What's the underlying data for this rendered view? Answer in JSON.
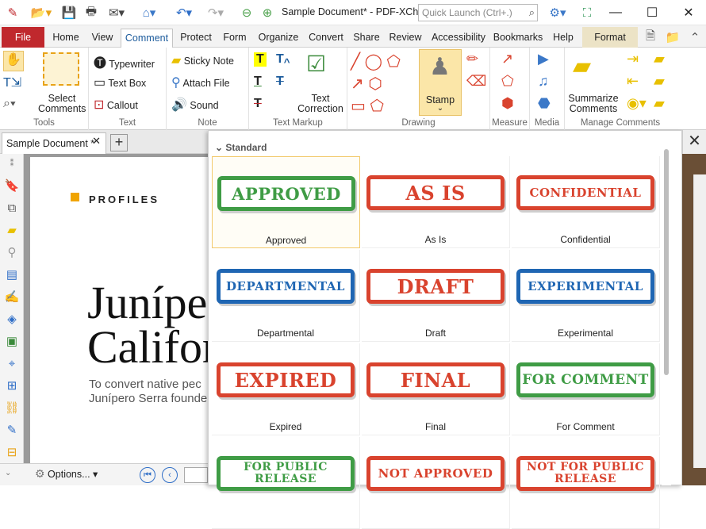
{
  "window": {
    "title": "Sample Document* - PDF-XCh...",
    "quick_launch_placeholder": "Quick Launch (Ctrl+.)"
  },
  "tabs": [
    "File",
    "Home",
    "View",
    "Comment",
    "Protect",
    "Form",
    "Organize",
    "Convert",
    "Share",
    "Review",
    "Accessibility",
    "Bookmarks",
    "Help",
    "Format"
  ],
  "ribbon": {
    "tools": {
      "select_comments": "Select\nComments",
      "group": "Tools"
    },
    "text": {
      "typewriter": "Typewriter",
      "text_box": "Text Box",
      "callout": "Callout",
      "group": "Text"
    },
    "note": {
      "sticky_note": "Sticky Note",
      "attach_file": "Attach File",
      "sound": "Sound",
      "group": "Note"
    },
    "markup": {
      "text_correction": "Text\nCorrection",
      "group": "Text Markup"
    },
    "drawing": {
      "stamp": "Stamp",
      "group": "Drawing"
    },
    "measure": {
      "group": "Measure"
    },
    "media": {
      "group": "Media"
    },
    "manage": {
      "summarize": "Summarize\nComments",
      "group": "Manage Comments"
    }
  },
  "doc_tab": {
    "label": "Sample Document *"
  },
  "document": {
    "profiles": "PROFILES",
    "headline1": "Junípe",
    "headline2": "Califor",
    "para1": "To convert native pec",
    "para2": "Junípero Serra founde"
  },
  "bottom": {
    "options": "Options..."
  },
  "stamp_panel": {
    "section": "Standard",
    "stamps": [
      {
        "text": "APPROVED",
        "label": "Approved",
        "color": "#3f9c45"
      },
      {
        "text": "AS IS",
        "label": "As Is",
        "color": "#d9432e"
      },
      {
        "text": "CONFIDENTIAL",
        "label": "Confidential",
        "color": "#d9432e"
      },
      {
        "text": "DEPARTMENTAL",
        "label": "Departmental",
        "color": "#1f66b3"
      },
      {
        "text": "DRAFT",
        "label": "Draft",
        "color": "#d9432e"
      },
      {
        "text": "EXPERIMENTAL",
        "label": "Experimental",
        "color": "#1f66b3"
      },
      {
        "text": "EXPIRED",
        "label": "Expired",
        "color": "#d9432e"
      },
      {
        "text": "FINAL",
        "label": "Final",
        "color": "#d9432e"
      },
      {
        "text": "FOR COMMENT",
        "label": "For Comment",
        "color": "#3f9c45"
      },
      {
        "text": "FOR PUBLIC\nRELEASE",
        "label": "",
        "color": "#3f9c45"
      },
      {
        "text": "NOT APPROVED",
        "label": "",
        "color": "#d9432e"
      },
      {
        "text": "NOT FOR PUBLIC\nRELEASE",
        "label": "",
        "color": "#d9432e"
      }
    ]
  }
}
